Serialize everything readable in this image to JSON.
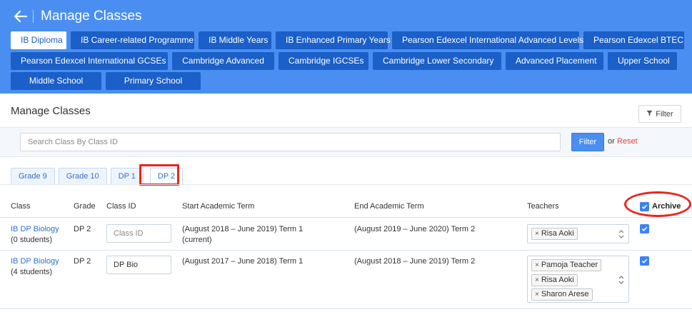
{
  "header": {
    "title": "Manage Classes",
    "programmes_row1": [
      "IB Diploma",
      "IB Career-related Programme",
      "IB Middle Years",
      "IB Enhanced Primary Years",
      "Pearson Edexcel International Advanced Levels",
      "Pearson Edexcel BTEC"
    ],
    "programmes_row2": [
      "Pearson Edexcel International GCSEs",
      "Cambridge Advanced",
      "Cambridge IGCSEs",
      "Cambridge Lower Secondary",
      "Advanced Placement",
      "Upper School"
    ],
    "programmes_row3": [
      "Middle School",
      "Primary School"
    ],
    "active_programme": "IB Diploma"
  },
  "page": {
    "title": "Manage Classes",
    "filter_button": "Filter"
  },
  "search": {
    "placeholder": "Search Class By Class ID",
    "value": "",
    "filter_button": "Filter",
    "or_text": "or",
    "reset_link": "Reset"
  },
  "tabs": {
    "items": [
      "Grade 9",
      "Grade 10",
      "DP 1",
      "DP 2"
    ],
    "active": "DP 2"
  },
  "table": {
    "columns": {
      "class": "Class",
      "grade": "Grade",
      "class_id": "Class ID",
      "start_term": "Start Academic Term",
      "end_term": "End Academic Term",
      "teachers": "Teachers",
      "archive": "Archive"
    },
    "archive_all_checked": true,
    "rows": [
      {
        "class_name": "IB DP Biology",
        "students": "(0 students)",
        "grade": "DP 2",
        "class_id_value": "",
        "class_id_placeholder": "Class ID",
        "start_term_line1": "(August 2018 – June 2019) Term 1",
        "start_term_line2": "(current)",
        "end_term": "(August 2019 – June 2020) Term 2",
        "teachers": [
          "Risa Aoki"
        ],
        "archived": true
      },
      {
        "class_name": "IB DP Biology",
        "students": "(4 students)",
        "grade": "DP 2",
        "class_id_value": "DP Bio",
        "class_id_placeholder": "Class ID",
        "start_term_line1": "(August 2017 – June 2018) Term 1",
        "start_term_line2": "",
        "end_term": "(August 2018 – June 2019) Term 2",
        "teachers": [
          "Pamoja Teacher",
          "Risa Aoki",
          "Sharon Arese"
        ],
        "archived": true
      }
    ]
  },
  "colors": {
    "header_bg": "#4a8ef2",
    "programme_button": "#1b5fc8",
    "highlight_red": "#e8261f",
    "link_blue": "#2f6fd0"
  }
}
